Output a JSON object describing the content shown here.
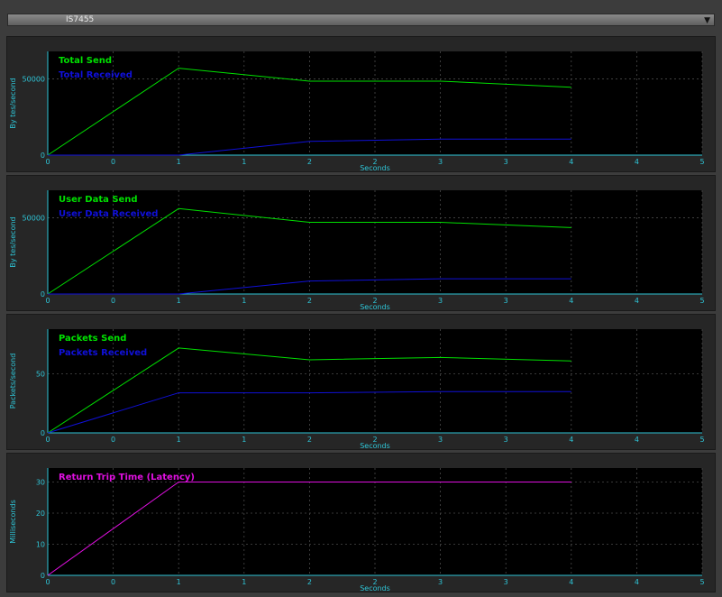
{
  "selector": {
    "value": "IS7455"
  },
  "chart_data": [
    {
      "type": "line",
      "ylabel": "By tes/second",
      "xlabel": "Seconds",
      "xticks": [
        "0",
        "0",
        "1",
        "1",
        "2",
        "2",
        "3",
        "3",
        "4",
        "4",
        "5"
      ],
      "yticks": [
        0,
        50000
      ],
      "ylim": [
        0,
        68000
      ],
      "grid": true,
      "legend_position": "top-left",
      "series": [
        {
          "name": "Total Send",
          "color": "#00e000",
          "x": [
            0,
            1,
            2,
            3,
            4
          ],
          "y": [
            0,
            57000,
            48500,
            48500,
            44500
          ]
        },
        {
          "name": "Total Received",
          "color": "#1010d8",
          "x": [
            0,
            1,
            2,
            3,
            4
          ],
          "y": [
            0,
            0,
            9000,
            10500,
            10500
          ]
        }
      ]
    },
    {
      "type": "line",
      "ylabel": "By tes/second",
      "xlabel": "Seconds",
      "xticks": [
        "0",
        "0",
        "1",
        "1",
        "2",
        "2",
        "3",
        "3",
        "4",
        "4",
        "5"
      ],
      "yticks": [
        0,
        50000
      ],
      "ylim": [
        0,
        68000
      ],
      "grid": true,
      "legend_position": "top-left",
      "series": [
        {
          "name": "User Data Send",
          "color": "#00e000",
          "x": [
            0,
            1,
            2,
            3,
            4
          ],
          "y": [
            0,
            56000,
            47000,
            47000,
            43500
          ]
        },
        {
          "name": "User Data Received",
          "color": "#1010d8",
          "x": [
            0,
            1,
            2,
            3,
            4
          ],
          "y": [
            0,
            0,
            8500,
            10000,
            10000
          ]
        }
      ]
    },
    {
      "type": "line",
      "ylabel": "Packets/second",
      "xlabel": "Seconds",
      "xticks": [
        "0",
        "0",
        "1",
        "1",
        "2",
        "2",
        "3",
        "3",
        "4",
        "4",
        "5"
      ],
      "yticks": [
        0,
        50
      ],
      "ylim": [
        0,
        88
      ],
      "grid": true,
      "legend_position": "top-left",
      "series": [
        {
          "name": "Packets Send",
          "color": "#00e000",
          "x": [
            0,
            1,
            2,
            3,
            4
          ],
          "y": [
            0,
            72,
            62,
            64,
            61
          ]
        },
        {
          "name": "Packets Received",
          "color": "#1010d8",
          "x": [
            0,
            1,
            2,
            3,
            4
          ],
          "y": [
            0,
            34,
            34,
            35,
            35
          ]
        }
      ]
    },
    {
      "type": "line",
      "ylabel": "Milliseconds",
      "xlabel": "Seconds",
      "xticks": [
        "0",
        "0",
        "1",
        "1",
        "2",
        "2",
        "3",
        "3",
        "4",
        "4",
        "5"
      ],
      "yticks": [
        0,
        10,
        20,
        30
      ],
      "ylim": [
        0,
        34.5
      ],
      "grid": true,
      "legend_position": "top-left",
      "series": [
        {
          "name": "Return Trip Time (Latency)",
          "color": "#e010e0",
          "x": [
            0,
            1,
            2,
            3,
            4
          ],
          "y": [
            0,
            30,
            30,
            30,
            30
          ]
        }
      ]
    }
  ]
}
